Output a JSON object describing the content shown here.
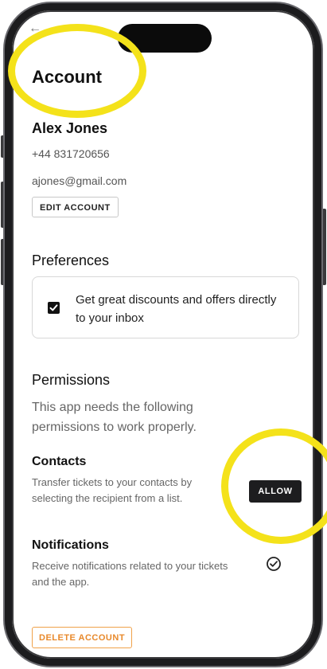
{
  "account": {
    "title": "Account",
    "name": "Alex Jones",
    "phone": "+44 831720656",
    "email": "ajones@gmail.com",
    "edit_button": "EDIT ACCOUNT"
  },
  "preferences": {
    "heading": "Preferences",
    "option_text": "Get great discounts and offers directly to your inbox",
    "option_checked": true
  },
  "permissions": {
    "heading": "Permissions",
    "description": "This app needs the following permissions to work properly.",
    "contacts": {
      "title": "Contacts",
      "description": "Transfer tickets to your contacts by selecting the recipient from a list.",
      "button": "ALLOW"
    },
    "notifications": {
      "title": "Notifications",
      "description": "Receive notifications related to your tickets and the app.",
      "status_icon": "check-circle-icon"
    }
  },
  "delete_button": "DELETE ACCOUNT",
  "colors": {
    "highlight": "#f4e21a",
    "delete_accent": "#e8892b",
    "allow_button_bg": "#1d1d1f"
  }
}
